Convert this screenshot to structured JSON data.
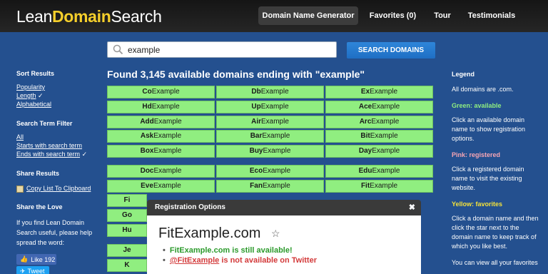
{
  "header": {
    "logo_plain": "Lean",
    "logo_highlight": "DomainSearch",
    "logo_tail": "Search",
    "nav": [
      {
        "label": "Domain Name Generator",
        "active": true
      },
      {
        "label": "Favorites (0)",
        "active": false
      },
      {
        "label": "Tour",
        "active": false
      },
      {
        "label": "Testimonials",
        "active": false
      }
    ]
  },
  "search": {
    "value": "example",
    "placeholder": "",
    "button_label": "SEARCH DOMAINS"
  },
  "sidebar": {
    "sort_title": "Sort Results",
    "sort_items": [
      "Popularity",
      "Length",
      "Alphabetical"
    ],
    "sort_checked_suffix": "✓",
    "filter_title": "Search Term Filter",
    "filter_items": [
      "All",
      "Starts with search term",
      "Ends with search term"
    ],
    "share_title": "Share Results",
    "copy_label": "Copy List To Clipboard",
    "love_title": "Share the Love",
    "love_text_1": "If you find Lean Domain",
    "love_text_2": "Search useful, please help",
    "love_text_3": "spread the word:",
    "like_label": "Like",
    "like_count": "192",
    "tweet_label": "Tweet"
  },
  "results": {
    "title": "Found 3,145 available domains ending with \"example\"",
    "rows": [
      [
        [
          "Co",
          "Example"
        ],
        [
          "Db",
          "Example"
        ],
        [
          "Ex",
          "Example"
        ]
      ],
      [
        [
          "Hd",
          "Example"
        ],
        [
          "Up",
          "Example"
        ],
        [
          "Ace",
          "Example"
        ]
      ],
      [
        [
          "Add",
          "Example"
        ],
        [
          "Air",
          "Example"
        ],
        [
          "Arc",
          "Example"
        ]
      ],
      [
        [
          "Ask",
          "Example"
        ],
        [
          "Bar",
          "Example"
        ],
        [
          "Bit",
          "Example"
        ]
      ],
      [
        [
          "Box",
          "Example"
        ],
        [
          "Buy",
          "Example"
        ],
        [
          "Day",
          "Example"
        ]
      ],
      [
        [
          "Doc",
          "Example"
        ],
        [
          "Eco",
          "Example"
        ],
        [
          "Edu",
          "Example"
        ]
      ],
      [
        [
          "Eve",
          "Example"
        ],
        [
          "Fan",
          "Example"
        ],
        [
          "Fit",
          "Example"
        ]
      ],
      [
        [
          "Fi",
          "",
          ""
        ],
        [
          "",
          ""
        ],
        [
          "",
          ""
        ]
      ],
      [
        [
          "Go",
          "",
          ""
        ],
        [
          "",
          ""
        ],
        [
          "",
          ""
        ]
      ],
      [
        [
          "Hu",
          "",
          ""
        ],
        [
          "",
          ""
        ],
        [
          "",
          ""
        ]
      ],
      [
        [
          "Je",
          "",
          ""
        ],
        [
          "",
          ""
        ],
        [
          "",
          ""
        ]
      ],
      [
        [
          "K",
          "",
          ""
        ],
        [
          "",
          ""
        ],
        [
          "",
          ""
        ]
      ]
    ]
  },
  "legend": {
    "title": "Legend",
    "all_com": "All domains are .com.",
    "green_label": "Green: available",
    "green_text": [
      "Click an available domain",
      "name to show registration",
      "options."
    ],
    "pink_label": "Pink: registered",
    "pink_text": [
      "Click a registered domain",
      "name to visit the existing",
      "website."
    ],
    "yellow_label": "Yellow: favorites",
    "yellow_text": [
      "Click a domain name and then",
      "click the star next to the",
      "domain name to keep track of",
      "which you like best."
    ],
    "tail_text": "You can view all your favorites"
  },
  "modal": {
    "title": "Registration Options",
    "close": "✖",
    "domain": "FitExample.com",
    "star": "☆",
    "available_text": "FitExample.com is still available!",
    "twitter_handle": "@FitExample",
    "twitter_text": " is not available on Twitter"
  },
  "colors": {
    "background": "#24508f",
    "available": "#90ee80",
    "registered": "#f8a6b4",
    "favorites": "#f5e23a",
    "accent": "#1f6fc4"
  }
}
